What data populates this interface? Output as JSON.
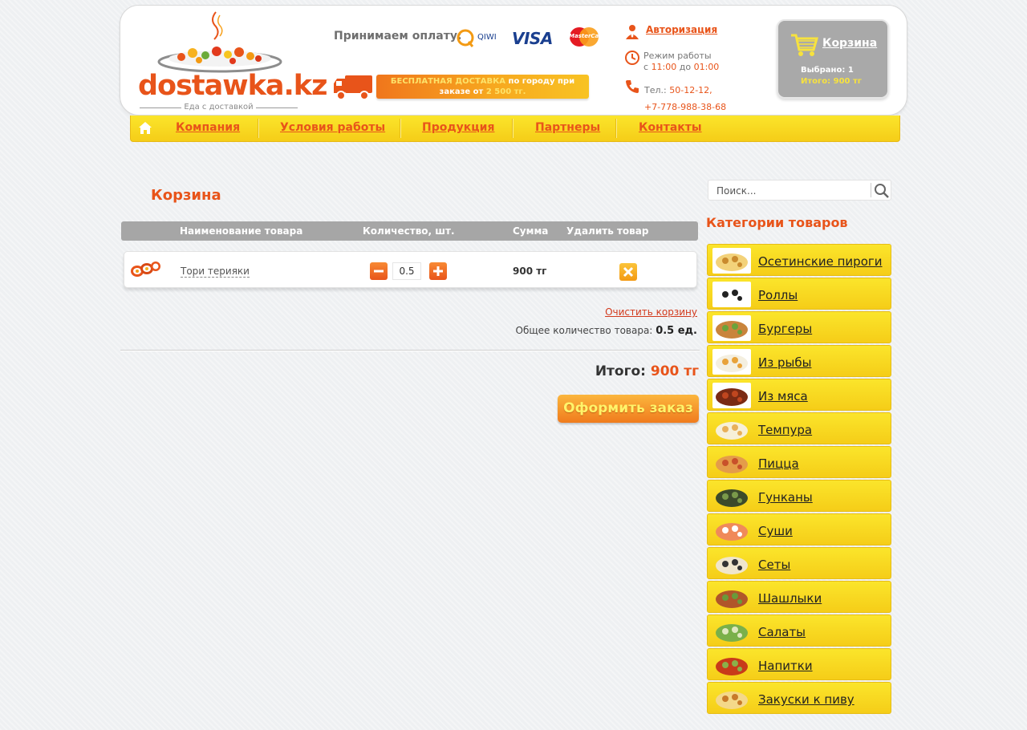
{
  "header": {
    "logo_text": "dostawka.kz",
    "logo_subtitle": "Еда с доставкой",
    "payment_label": "Принимаем оплату:",
    "payment_methods": [
      "QIWI",
      "VISA",
      "MasterCard"
    ],
    "delivery_banner": {
      "highlight": "БЕСПЛАТНАЯ ДОСТАВКА",
      "text": "по городу при заказе от",
      "amount": "2 500 тг."
    },
    "auth_link": "Авторизация",
    "work_hours": {
      "label": "Режим работы",
      "from_prefix": "с",
      "from": "11:00",
      "to_prefix": "до",
      "to": "01:00"
    },
    "phone": {
      "label": "Тел.:",
      "number1": "50-12-12,",
      "number2": "+7-778-988-38-68"
    },
    "cart": {
      "link": "Корзина",
      "selected_label": "Выбрано:",
      "selected_value": "1",
      "total_label": "Итого:",
      "total_value": "900 тг"
    }
  },
  "nav": {
    "items": [
      "Компания",
      "Условия работы",
      "Продукция",
      "Партнеры",
      "Контакты"
    ]
  },
  "main": {
    "title": "Корзина",
    "table": {
      "columns": [
        "Наименование товара",
        "Количество, шт.",
        "Сумма",
        "Удалить товар"
      ],
      "rows": [
        {
          "name": "Тори терияки",
          "quantity": "0.5",
          "sum": "900 тг"
        }
      ]
    },
    "clear_cart": "Очистить корзину",
    "total_qty_label": "Общее количество товара:",
    "total_qty_value": "0.5 ед.",
    "total_label": "Итого:",
    "total_value": "900 тг",
    "checkout_button": "Оформить заказ"
  },
  "sidebar": {
    "search_placeholder": "Поиск...",
    "categories_title": "Категории товаров",
    "categories": [
      {
        "label": "Осетинские пироги",
        "icon": "pie-icon"
      },
      {
        "label": "Роллы",
        "icon": "rolls-icon"
      },
      {
        "label": "Бургеры",
        "icon": "burger-icon"
      },
      {
        "label": "Из рыбы",
        "icon": "fish-icon"
      },
      {
        "label": "Из мяса",
        "icon": "meat-icon"
      },
      {
        "label": "Темпура",
        "icon": "tempura-icon"
      },
      {
        "label": "Пицца",
        "icon": "pizza-icon"
      },
      {
        "label": "Гунканы",
        "icon": "gunkan-icon"
      },
      {
        "label": "Суши",
        "icon": "sushi-icon"
      },
      {
        "label": "Сеты",
        "icon": "sets-icon"
      },
      {
        "label": "Шашлыки",
        "icon": "shashlik-icon"
      },
      {
        "label": "Салаты",
        "icon": "salad-icon"
      },
      {
        "label": "Напитки",
        "icon": "drinks-icon"
      },
      {
        "label": "Закуски к пиву",
        "icon": "beer-snacks-icon"
      }
    ]
  },
  "colors": {
    "accent": "#e8541a",
    "nav_yellow": "#f8d81f",
    "cart_grey": "#a9a9a9"
  }
}
